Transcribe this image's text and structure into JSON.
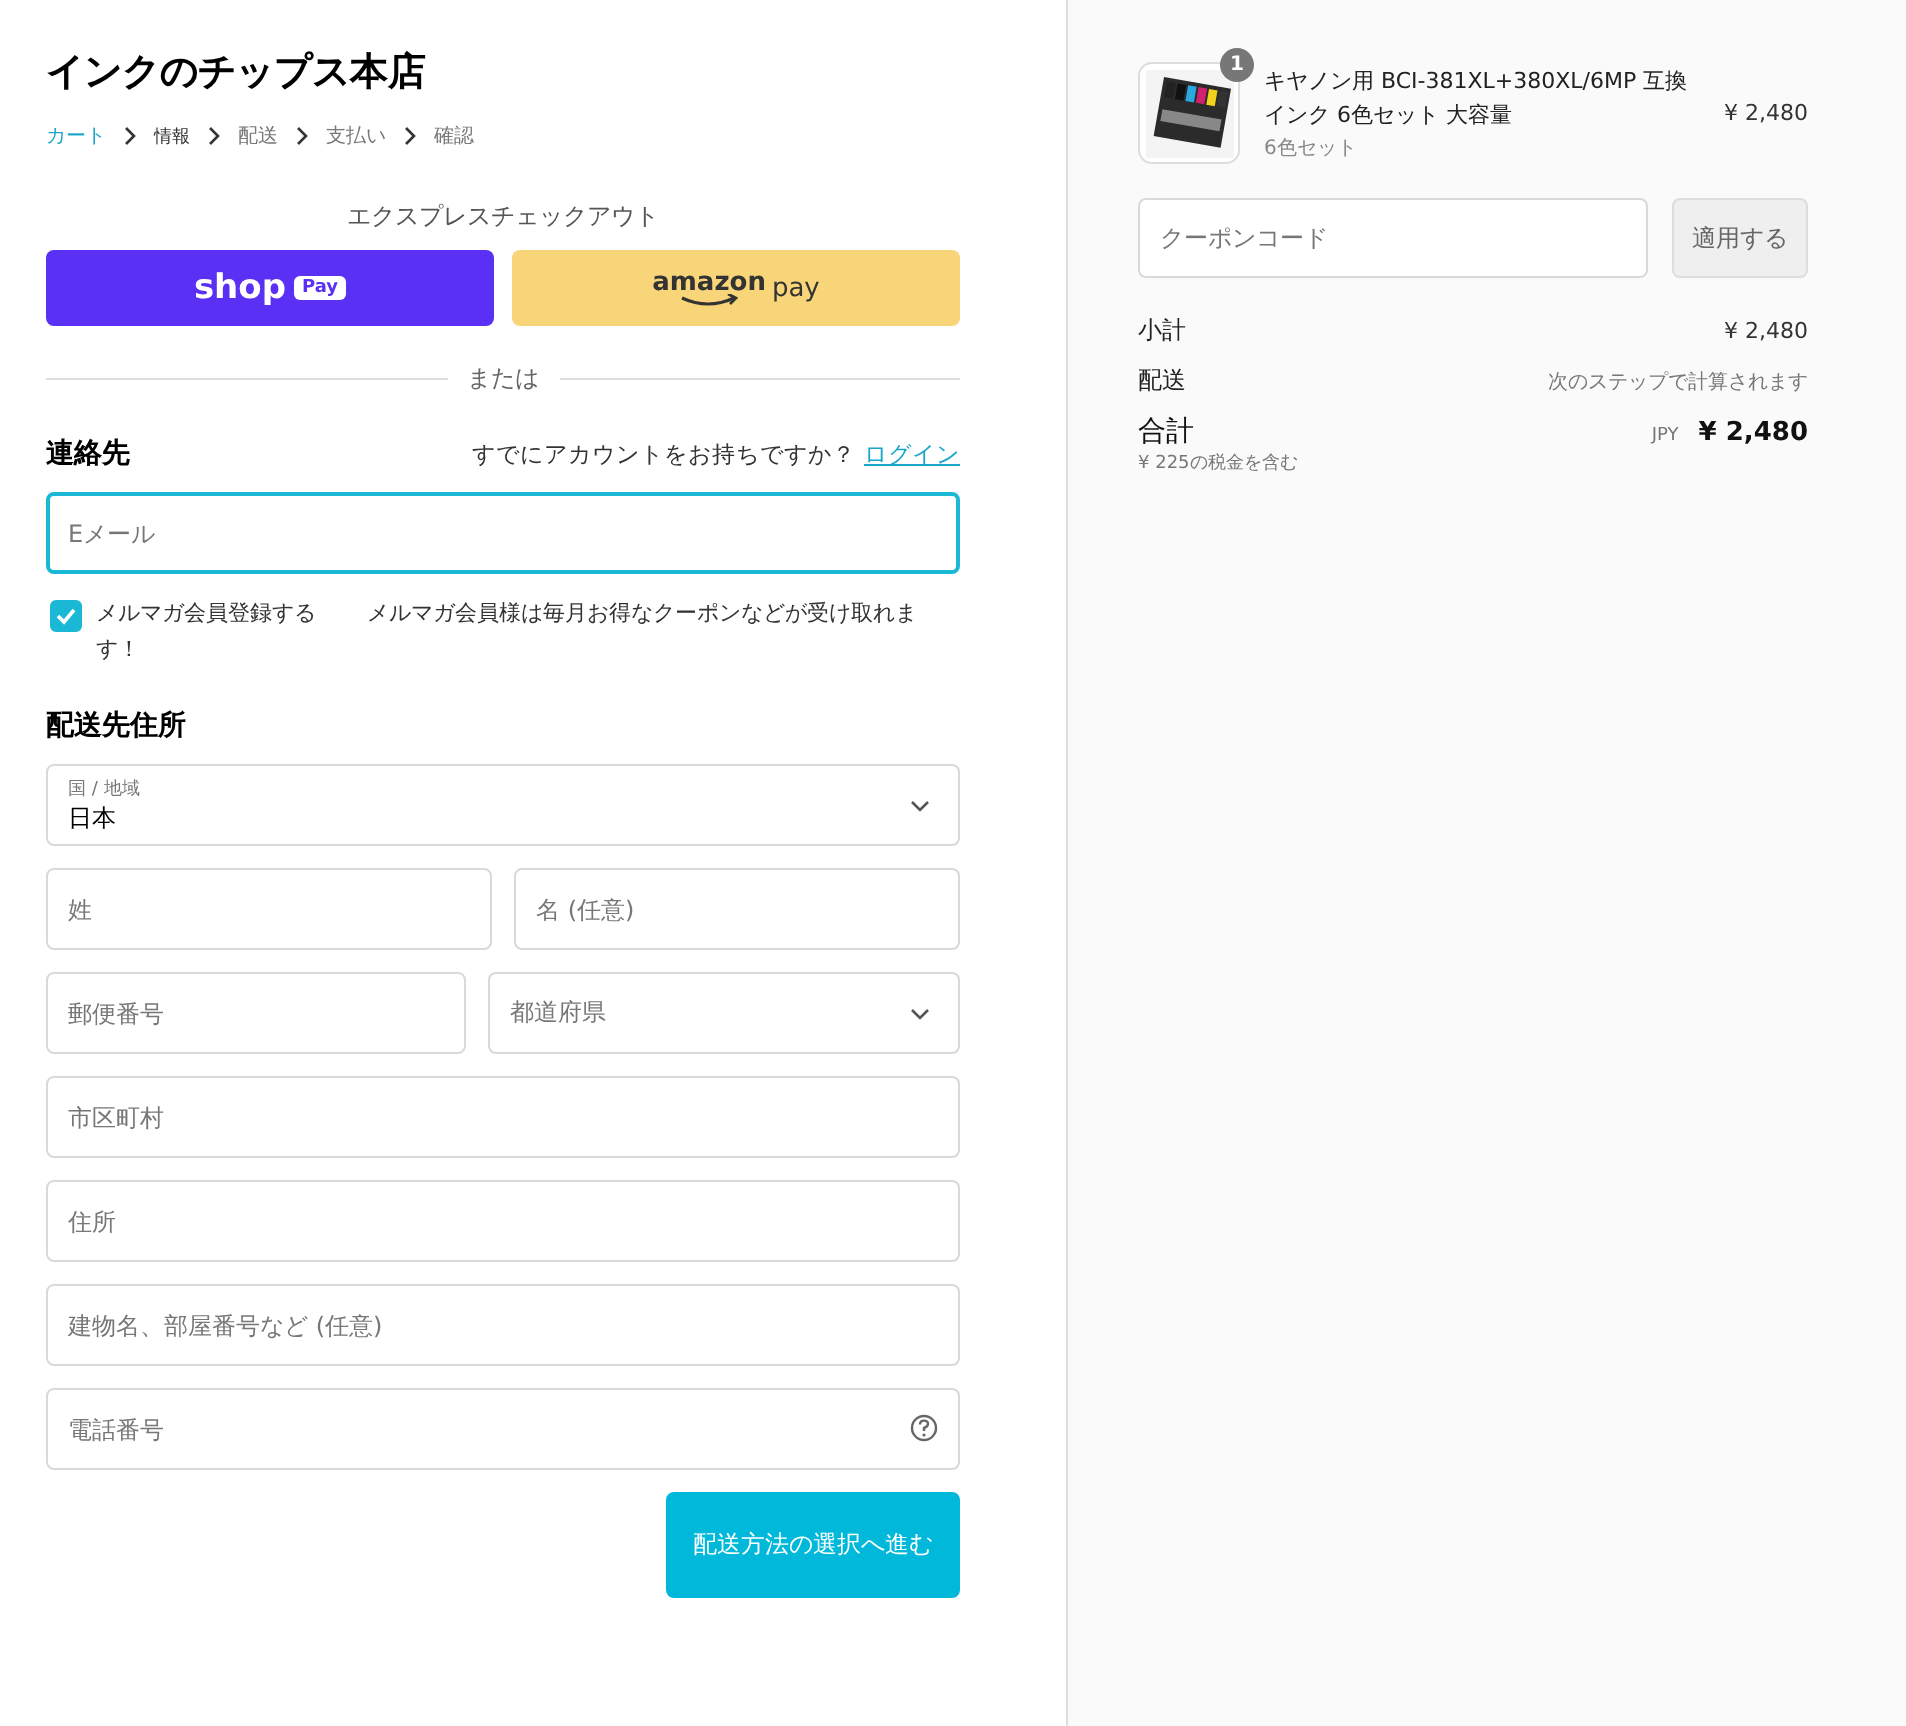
{
  "shop_title": "インクのチップス本店",
  "breadcrumb": [
    {
      "label": "カート",
      "kind": "link"
    },
    {
      "label": "情報",
      "kind": "current"
    },
    {
      "label": "配送",
      "kind": "upcoming"
    },
    {
      "label": "支払い",
      "kind": "upcoming"
    },
    {
      "label": "確認",
      "kind": "upcoming"
    }
  ],
  "express_checkout": {
    "title": "エクスプレスチェックアウト",
    "buttons": [
      {
        "kind": "shop_pay",
        "text": "shop",
        "badge": "Pay"
      },
      {
        "kind": "amazon_pay",
        "text": "amazon",
        "suffix": "pay"
      }
    ],
    "divider": "または"
  },
  "contact": {
    "heading": "連絡先",
    "login_prompt": "すでにアカウントをお持ちですか？",
    "login_link": "ログイン",
    "email": {
      "placeholder": "Eメール",
      "focused": true
    },
    "newsletter": {
      "label": "メルマガ会員登録する　　 メルマガ会員様は毎月お得なクーポンなどが受け取れます！",
      "checked": true
    }
  },
  "shipping_address": {
    "heading": "配送先住所",
    "rows": [
      [
        {
          "kind": "select",
          "label": "国 / 地域",
          "value": "日本"
        }
      ],
      [
        {
          "kind": "text",
          "placeholder": "姓"
        },
        {
          "kind": "text",
          "placeholder": "名 (任意)"
        }
      ],
      [
        {
          "kind": "text",
          "placeholder": "郵便番号"
        },
        {
          "kind": "select",
          "placeholder": "都道府県"
        }
      ],
      [
        {
          "kind": "text",
          "placeholder": "市区町村"
        }
      ],
      [
        {
          "kind": "text",
          "placeholder": "住所"
        }
      ],
      [
        {
          "kind": "text",
          "placeholder": "建物名、部屋番号など (任意)"
        }
      ],
      [
        {
          "kind": "help",
          "placeholder": "電話番号"
        }
      ]
    ]
  },
  "continue_button": "配送方法の選択へ進む",
  "order_summary": {
    "items": [
      {
        "name": "キヤノン用 BCI-381XL+380XL/6MP 互換インク 6色セット 大容量",
        "variant": "6色セット",
        "quantity": "1",
        "price": "¥ 2,480"
      }
    ],
    "coupon": {
      "placeholder": "クーポンコード",
      "button": "適用する"
    },
    "lines": [
      {
        "label": "小計",
        "value": "¥ 2,480"
      },
      {
        "label": "配送",
        "value": "次のステップで計算されます",
        "kind": "note"
      }
    ],
    "total": {
      "label": "合計",
      "tax_note": "¥ 225の税金を含む",
      "currency": "JPY",
      "value": "¥ 2,480"
    }
  }
}
